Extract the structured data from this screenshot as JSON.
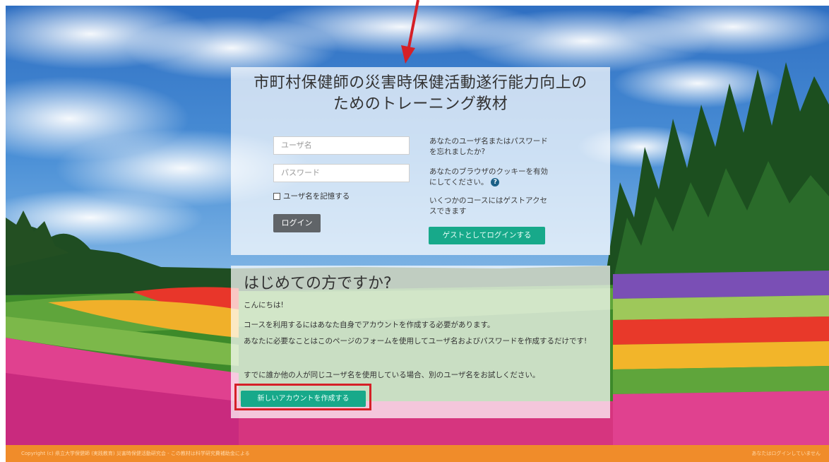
{
  "site": {
    "title_line1": "市町村保健師の災害時保健活動遂行能力向上の",
    "title_line2": "ためのトレーニング教材"
  },
  "login": {
    "username_placeholder": "ユーザ名",
    "password_placeholder": "パスワード",
    "remember_label": "ユーザ名を記憶する",
    "login_button": "ログイン",
    "forgot_line1": "あなたのユーザ名またはパスワード",
    "forgot_line2": "を忘れましたか?",
    "cookie_line1": "あなたのブラウザのクッキーを有効",
    "cookie_line2": "にしてください。",
    "help_icon_glyph": "?",
    "guest_line1": "いくつかのコースにはゲストアクセ",
    "guest_line2": "スできます",
    "guest_button": "ゲストとしてログインする"
  },
  "signup": {
    "heading": "はじめての方ですか?",
    "hello": "こんにちは!",
    "p1": "コースを利用するにはあなた自身でアカウントを作成する必要があります。",
    "p2": "あなたに必要なことはこのページのフォームを使用してユーザ名およびパスワードを作成するだけです!",
    "p3": "すでに誰か他の人が同じユーザ名を使用している場合、別のユーザ名をお試しください。",
    "create_button": "新しいアカウントを作成する"
  },
  "footer": {
    "left_text": "Copyright (c) 県立大学保健師 (実践教育) 災害時保健活動研究会 - この教材は科学研究費補助金による",
    "right_text": "あなたはログインしていません"
  },
  "colors": {
    "accent_green": "#17a98a",
    "footer_orange": "#f08c2a",
    "annotation_red": "#d52027",
    "login_button_gray": "#606468"
  },
  "icons": {
    "help": "question-circle-icon",
    "annotation": "red-arrow-icon"
  }
}
